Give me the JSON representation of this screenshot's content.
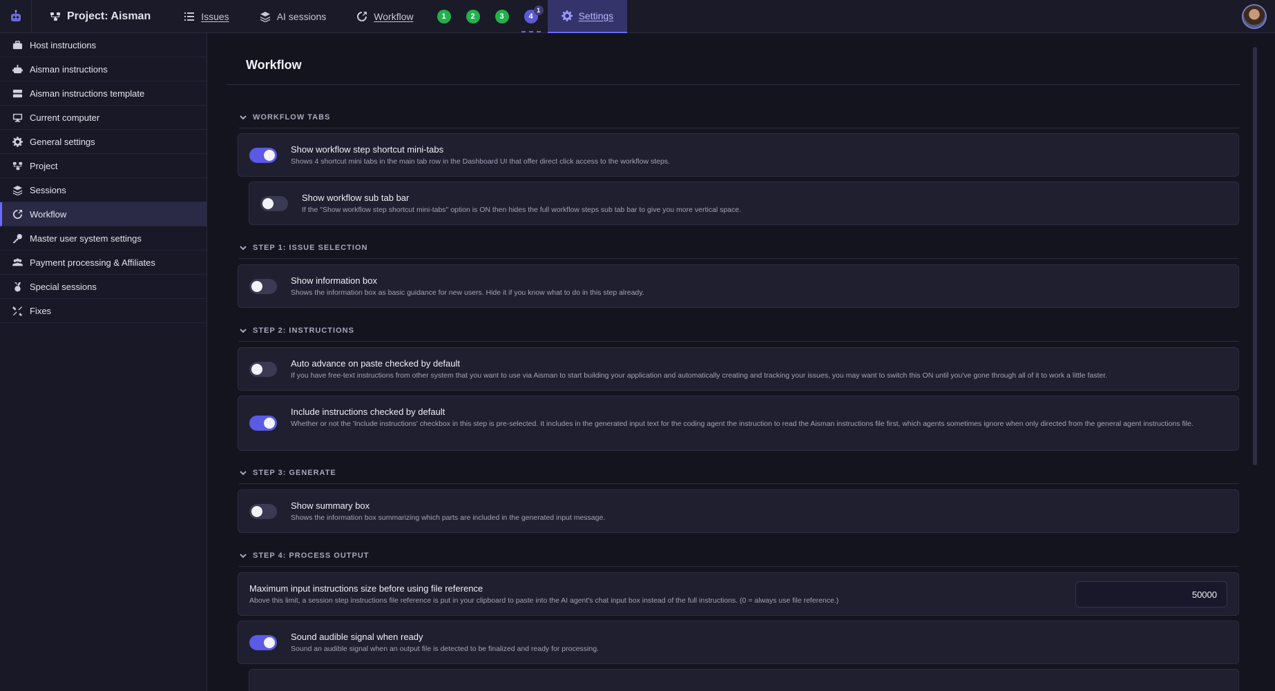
{
  "topbar": {
    "project_label": "Project: Aisman",
    "tabs": [
      "Issues",
      "AI sessions",
      "Workflow"
    ],
    "steps": [
      "1",
      "2",
      "3",
      "4"
    ],
    "step4_badge": "1",
    "settings_label": "Settings"
  },
  "sidebar": {
    "items": [
      "Host instructions",
      "Aisman instructions",
      "Aisman instructions template",
      "Current computer",
      "General settings",
      "Project",
      "Sessions",
      "Workflow",
      "Master user system settings",
      "Payment processing & Affiliates",
      "Special sessions",
      "Fixes"
    ]
  },
  "main": {
    "title": "Workflow",
    "sections": [
      "WORKFLOW TABS",
      "STEP 1: ISSUE SELECTION",
      "STEP 2: INSTRUCTIONS",
      "STEP 3: GENERATE",
      "STEP 4: PROCESS OUTPUT"
    ],
    "cards": [
      {
        "title": "Show workflow step shortcut mini-tabs",
        "desc": "Shows 4 shortcut mini tabs in the main tab row in the Dashboard UI that offer direct click access to the workflow steps."
      },
      {
        "title": "Show workflow sub tab bar",
        "desc": "If the \"Show workflow step shortcut mini-tabs\" option is ON then hides the full workflow steps sub tab bar to give you more vertical space."
      },
      {
        "title": "Show information box",
        "desc": "Shows the information box as basic guidance for new users. Hide it if you know what to do in this step already."
      },
      {
        "title": "Auto advance on paste checked by default",
        "desc": "If you have free-text instructions from other system that you want to use via Aisman to start building your application and automatically creating and tracking your issues, you may want to switch this ON until you've gone through all of it to work a little faster."
      },
      {
        "title": "Include instructions checked by default",
        "desc": "Whether or not the 'Include instructions' checkbox in this step is pre-selected. It includes in the generated input text for the coding agent the instruction to read the Aisman instructions file first, which agents sometimes ignore when only directed from the general agent instructions file."
      },
      {
        "title": "Show summary box",
        "desc": "Shows the information box summarizing which parts are included in the generated input message."
      },
      {
        "title": "Maximum input instructions size before using file reference",
        "desc": "Above this limit, a session step instructions file reference is put in your clipboard to paste into the AI agent's chat input box instead of the full instructions. (0 = always use file reference.)",
        "value": "50000"
      },
      {
        "title": "Sound audible signal when ready",
        "desc": "Sound an audible signal when an output file is detected to be finalized and ready for processing."
      }
    ]
  }
}
